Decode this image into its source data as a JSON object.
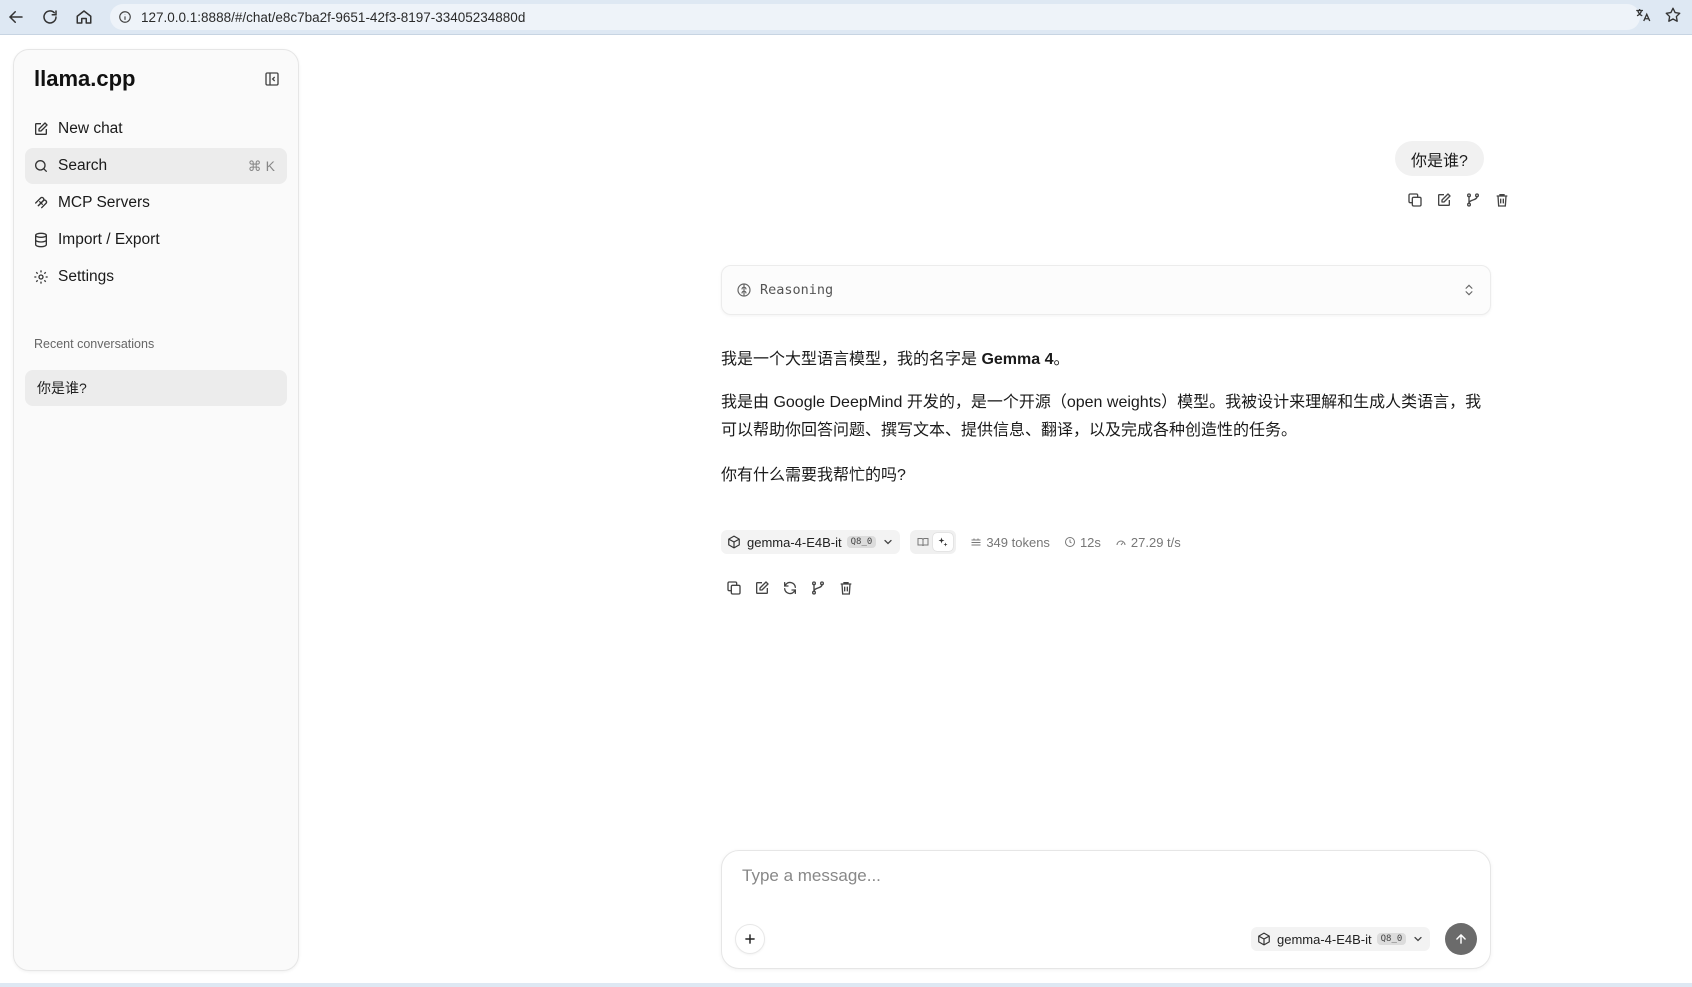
{
  "browser": {
    "url": "127.0.0.1:8888/#/chat/e8c7ba2f-9651-42f3-8197-33405234880d"
  },
  "sidebar": {
    "title": "llama.cpp",
    "items": [
      {
        "label": "New chat",
        "icon": "edit-icon"
      },
      {
        "label": "Search",
        "icon": "search-icon",
        "shortcut": "⌘ K"
      },
      {
        "label": "MCP Servers",
        "icon": "mcp-icon"
      },
      {
        "label": "Import / Export",
        "icon": "database-icon"
      },
      {
        "label": "Settings",
        "icon": "gear-icon"
      }
    ],
    "recent_heading": "Recent conversations",
    "conversations": [
      {
        "title": "你是谁?"
      }
    ]
  },
  "chat": {
    "user_message": "你是谁?",
    "reasoning_label": "Reasoning",
    "assistant": {
      "p1_prefix": "我是一个大型语言模型，我的名字是 ",
      "p1_bold": "Gemma 4",
      "p1_suffix": "。",
      "p2": "我是由 Google DeepMind 开发的，是一个开源（open weights）模型。我被设计来理解和生成人类语言，我可以帮助你回答问题、撰写文本、提供信息、翻译，以及完成各种创造性的任务。",
      "p3": "你有什么需要我帮忙的吗?"
    },
    "meta": {
      "model": "gemma-4-E4B-it",
      "quant": "Q8_0",
      "tokens": "349 tokens",
      "time": "12s",
      "speed": "27.29 t/s"
    }
  },
  "composer": {
    "placeholder": "Type a message...",
    "model": "gemma-4-E4B-it",
    "quant": "Q8_0"
  },
  "colors": {
    "browser_bar": "#dee8f3",
    "sidebar_bg": "#fafafa",
    "active_item": "#ececec",
    "send_button": "#6b6b6b"
  }
}
